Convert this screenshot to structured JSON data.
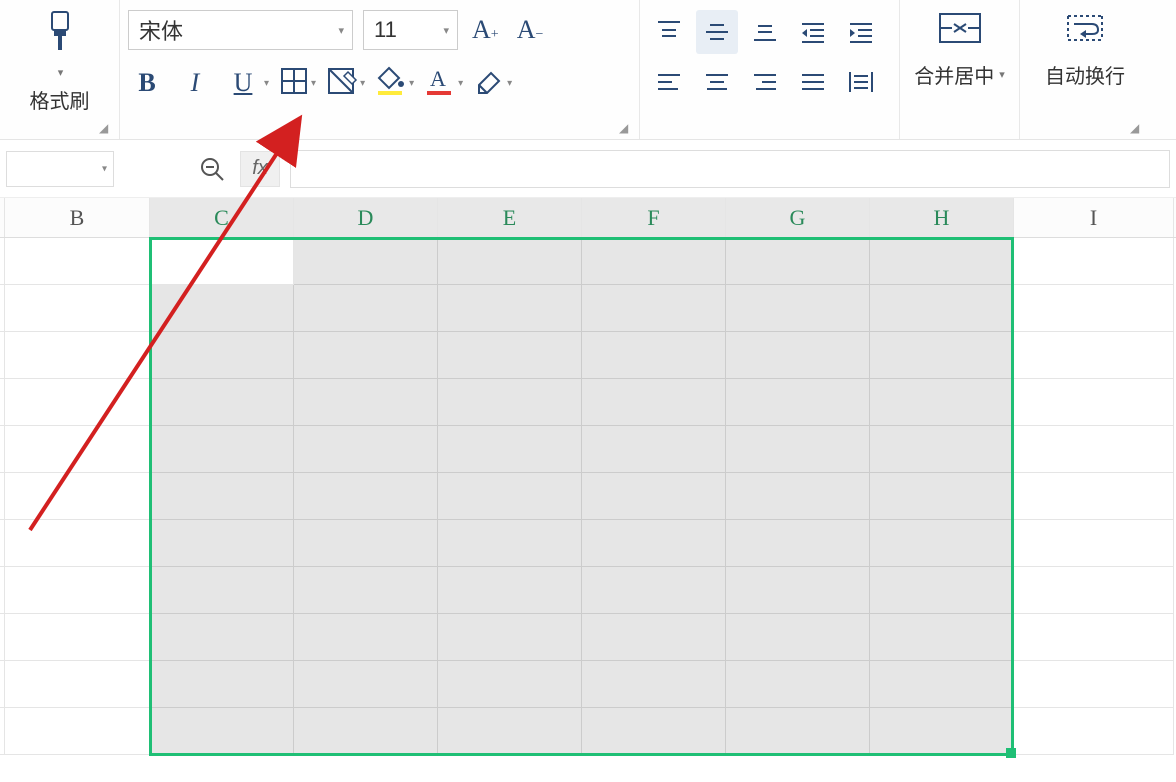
{
  "ribbon": {
    "format_painter": "格式刷",
    "font_name": "宋体",
    "font_size": "11",
    "merge_center": "合并居中",
    "auto_wrap": "自动换行"
  },
  "formula_bar": {
    "fx_label": "fx",
    "value": ""
  },
  "columns": [
    "B",
    "C",
    "D",
    "E",
    "F",
    "G",
    "H",
    "I"
  ],
  "selection": {
    "start": "C2",
    "end": "H12",
    "active": "C2"
  }
}
